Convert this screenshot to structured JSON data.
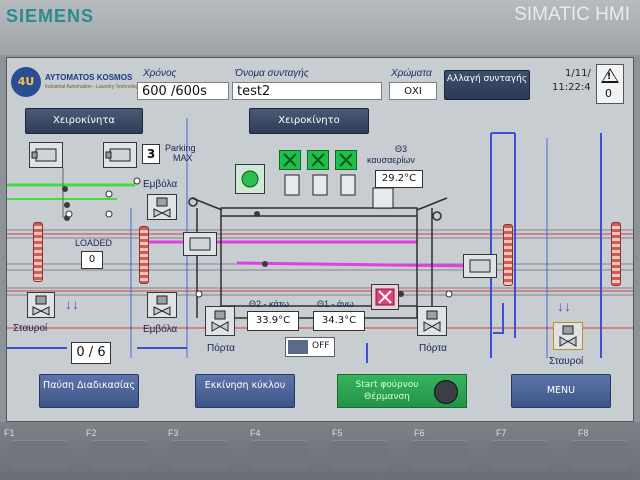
{
  "bezel": {
    "brand": "SIEMENS",
    "model": "SIMATIC HMI",
    "fkeys": [
      "F1",
      "F2",
      "F3",
      "F4",
      "F5",
      "F6",
      "F7",
      "F8"
    ]
  },
  "header": {
    "logo_mark": "4U",
    "logo_text": "AYTOMATOS KOSMOS",
    "logo_sub": "Industrial Automation - Laundry Technology",
    "time_label": "Χρόνος",
    "time_value": "600  /600s",
    "recipe_label": "Όνομα συνταγής",
    "recipe_value": "test2",
    "colors_label": "Χρώματα",
    "colors_value": "ΟΧΙ",
    "change_recipe_btn": "Αλλαγή συνταγής",
    "date": "1/11/",
    "time": "11:22:4",
    "alarm_count": "0"
  },
  "controls": {
    "manual_left": "Χειροκίνητα",
    "manual_center": "Χειροκίνητο",
    "parking_value": "3",
    "parking_label_1": "Parking",
    "parking_label_2": "MAX",
    "theta3_label_1": "Θ3",
    "theta3_label_2": "καυσαερίων",
    "theta3_value": "29.2°C",
    "embola_top": "Εμβόλα",
    "embola_bottom": "Εμβόλα",
    "loaded_label": "LOADED",
    "loaded_value": "0",
    "stavroi_left": "Σταυροί",
    "stavroi_right": "Σταυροί",
    "porta_left": "Πόρτα",
    "porta_right": "Πόρτα",
    "theta2_label": "Θ2 - κάτω",
    "theta2_value": "33.9°C",
    "theta1_label": "Θ1 - άνω",
    "theta1_value": "34.3°C",
    "toggle_state": "OFF",
    "counter": "0 / 6"
  },
  "bottom_buttons": {
    "pause": "Παύση Διαδικασίας",
    "start_cycle": "Εκκίνηση κύκλου",
    "start_oven": "Start φούρνου Θέρμανση",
    "menu": "MENU"
  },
  "colors": {
    "accent_green": "#1fc04a",
    "line_magenta": "#e040e0",
    "line_blue": "#3b4fd8",
    "line_red": "#d93a3a"
  }
}
